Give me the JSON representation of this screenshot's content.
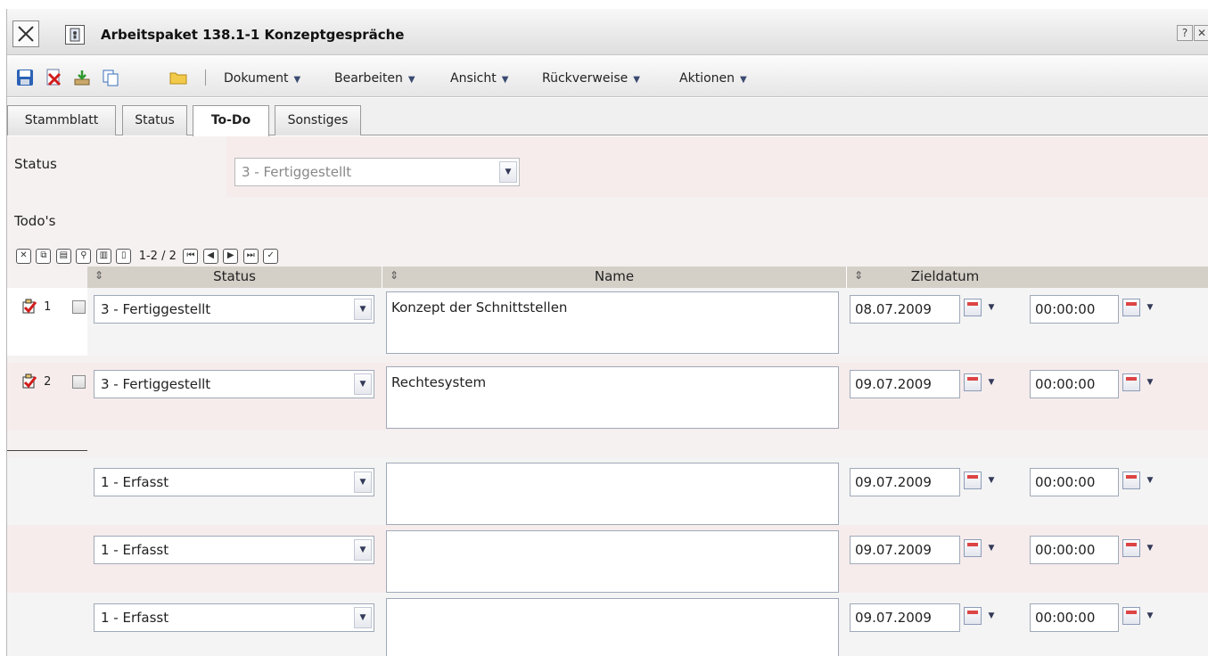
{
  "window": {
    "title": "Arbeitspaket 138.1-1 Konzeptgespräche",
    "help_label": "?",
    "close_label": "✕"
  },
  "toolbar": {
    "icons": [
      "save-icon",
      "delete-icon",
      "export-icon",
      "copy-icon",
      "folder-icon"
    ],
    "menus": [
      {
        "label": "Dokument"
      },
      {
        "label": "Bearbeiten"
      },
      {
        "label": "Ansicht"
      },
      {
        "label": "Rückverweise"
      },
      {
        "label": "Aktionen"
      }
    ]
  },
  "tabs": [
    {
      "label": "Stammblatt",
      "active": false
    },
    {
      "label": "Status",
      "active": false
    },
    {
      "label": "To-Do",
      "active": true
    },
    {
      "label": "Sonstiges",
      "active": false
    }
  ],
  "form": {
    "status_label": "Status",
    "status_value": "3 - Fertiggestellt",
    "todos_label": "Todo's"
  },
  "grid": {
    "pager": "1-2 / 2",
    "columns": {
      "status": "Status",
      "name": "Name",
      "zieldatum": "Zieldatum"
    },
    "rows": [
      {
        "num": "1",
        "status": "3 - Fertiggestellt",
        "name": "Konzept der Schnittstellen",
        "date": "08.07.2009",
        "time": "00:00:00"
      },
      {
        "num": "2",
        "status": "3 - Fertiggestellt",
        "name": "Rechtesystem",
        "date": "09.07.2009",
        "time": "00:00:00"
      }
    ],
    "new_rows": [
      {
        "status": "1 - Erfasst",
        "name": "",
        "date": "09.07.2009",
        "time": "00:00:00"
      },
      {
        "status": "1 - Erfasst",
        "name": "",
        "date": "09.07.2009",
        "time": "00:00:00"
      },
      {
        "status": "1 - Erfasst",
        "name": "",
        "date": "09.07.2009",
        "time": "00:00:00"
      }
    ]
  },
  "colors": {
    "accent": "#d21c1c",
    "row_alt": "#f6ecec",
    "header": "#d4d0c8"
  }
}
